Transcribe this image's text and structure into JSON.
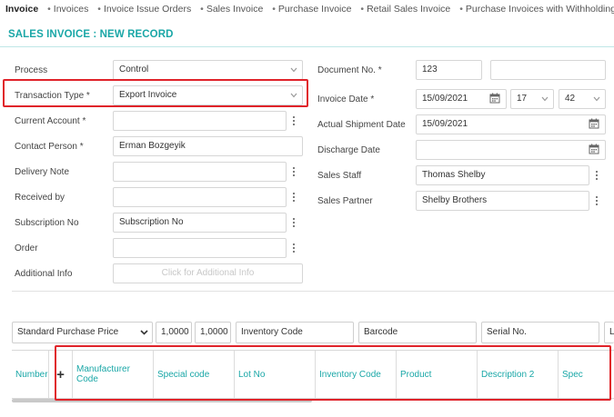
{
  "breadcrumb": {
    "items": [
      "Invoice",
      "Invoices",
      "Invoice Issue Orders",
      "Sales Invoice",
      "Purchase Invoice",
      "Retail Sales Invoice",
      "Purchase Invoices with Withholding"
    ]
  },
  "page": {
    "title": "SALES INVOICE : NEW RECORD"
  },
  "form_left": {
    "process": {
      "label": "Process",
      "value": "Control"
    },
    "transaction_type": {
      "label": "Transaction Type *",
      "value": "Export Invoice"
    },
    "current_account": {
      "label": "Current Account *",
      "value": ""
    },
    "contact_person": {
      "label": "Contact Person *",
      "value": "Erman Bozgeyik"
    },
    "delivery_note": {
      "label": "Delivery Note",
      "value": ""
    },
    "received_by": {
      "label": "Received by",
      "value": ""
    },
    "subscription_no": {
      "label": "Subscription No",
      "value": "Subscription No"
    },
    "order": {
      "label": "Order",
      "value": ""
    },
    "additional_info": {
      "label": "Additional Info",
      "placeholder": "Click for Additional Info"
    }
  },
  "form_right": {
    "document_no": {
      "label": "Document No. *",
      "value": "123",
      "value2": ""
    },
    "invoice_date": {
      "label": "Invoice Date *",
      "value": "15/09/2021",
      "hour": "17",
      "minute": "42"
    },
    "actual_shipment_date": {
      "label": "Actual Shipment Date",
      "value": "15/09/2021"
    },
    "discharge_date": {
      "label": "Discharge Date",
      "value": ""
    },
    "sales_staff": {
      "label": "Sales Staff",
      "value": "Thomas Shelby"
    },
    "sales_partner": {
      "label": "Sales Partner",
      "value": "Shelby Brothers"
    }
  },
  "controls": {
    "price_list": "Standard Purchase Price",
    "qty1": "1,0000",
    "qty2": "1,0000",
    "inventory_code": "Inventory Code",
    "barcode": "Barcode",
    "serial_no": "Serial No.",
    "extra": "L"
  },
  "grid": {
    "columns": [
      "Number",
      "+",
      "Manufacturer Code",
      "Special code",
      "Lot No",
      "Inventory Code",
      "Product",
      "Description 2",
      "Spec"
    ]
  },
  "colors": {
    "accent": "#1aa7a7",
    "highlight": "#e0232a"
  }
}
